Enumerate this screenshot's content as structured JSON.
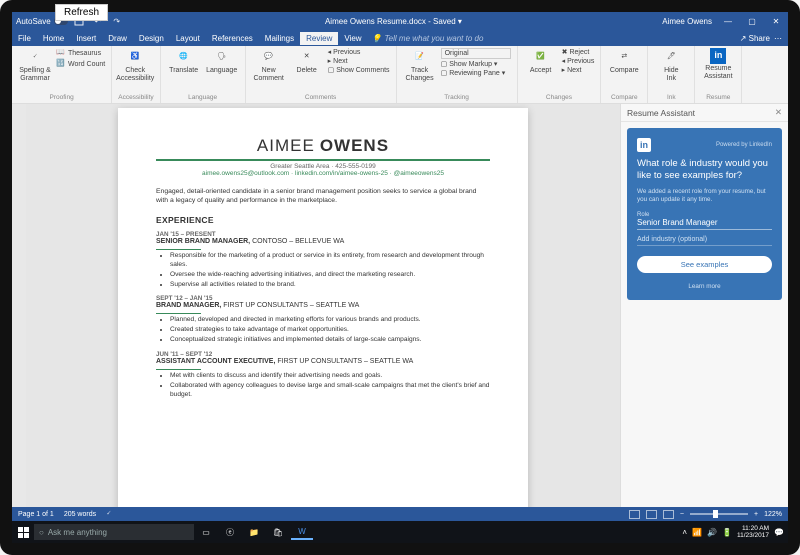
{
  "tooltip": {
    "refresh": "Refresh"
  },
  "titlebar": {
    "autosave_label": "AutoSave",
    "doc_title": "Aimee Owens Resume.docx - Saved ▾",
    "user": "Aimee Owens"
  },
  "tabs": {
    "items": [
      "File",
      "Home",
      "Insert",
      "Draw",
      "Design",
      "Layout",
      "References",
      "Mailings",
      "Review",
      "View"
    ],
    "tellme": "Tell me what you want to do",
    "share": "Share",
    "comments": "⋯"
  },
  "ribbon": {
    "proofing": {
      "label": "Proofing",
      "spelling": "Spelling &\nGrammar",
      "thesaurus": "Thesaurus",
      "wordcount": "Word Count"
    },
    "accessibility": {
      "label": "Accessibility",
      "check": "Check\nAccessibility"
    },
    "language": {
      "label": "Language",
      "translate": "Translate",
      "language": "Language"
    },
    "comments": {
      "label": "Comments",
      "new": "New\nComment",
      "delete": "Delete",
      "previous": "Previous",
      "next": "Next",
      "show": "Show Comments"
    },
    "tracking": {
      "label": "Tracking",
      "track": "Track\nChanges",
      "original": "Original",
      "markup": "Show Markup ▾",
      "pane": "Reviewing Pane ▾"
    },
    "changes": {
      "label": "Changes",
      "accept": "Accept",
      "reject": "Reject",
      "previous": "Previous",
      "next": "Next"
    },
    "compare": {
      "label": "Compare",
      "compare": "Compare"
    },
    "ink": {
      "label": "Ink",
      "hide": "Hide\nInk"
    },
    "resume": {
      "label": "Resume",
      "assistant": "Resume\nAssistant"
    }
  },
  "document": {
    "first_name": "AIMEE",
    "last_name": "OWENS",
    "contact1": "Greater Seattle Area  ·  425-555-0199",
    "contact2": "aimee.owens25@outlook.com · linkedin.com/in/aimee-owens-25 · @aimeeowens25",
    "summary": "Engaged, detail-oriented candidate in a senior brand management position seeks to service a global brand with a legacy of quality and performance in the marketplace.",
    "experience_heading": "EXPERIENCE",
    "jobs": [
      {
        "date": "JAN '15 – PRESENT",
        "title": "SENIOR BRAND MANAGER,",
        "company": " CONTOSO – BELLEVUE WA",
        "bullets": [
          "Responsible for the marketing of a product or service in its entirety, from research and development through sales.",
          "Oversee the wide-reaching advertising initiatives, and direct the marketing research.",
          "Supervise all activities related to the brand."
        ]
      },
      {
        "date": "SEPT '12 – JAN '15",
        "title": "BRAND MANAGER,",
        "company": " FIRST UP CONSULTANTS – SEATTLE WA",
        "bullets": [
          "Planned, developed and directed in marketing efforts for various brands and products.",
          "Created strategies to take advantage of market opportunities.",
          "Conceptualized strategic initiatives and implemented details of large-scale campaigns."
        ]
      },
      {
        "date": "JUN '11 – SEPT '12",
        "title": "ASSISTANT ACCOUNT EXECUTIVE,",
        "company": " FIRST UP CONSULTANTS – SEATTLE WA",
        "bullets": [
          "Met with clients to discuss and identify their advertising needs and goals.",
          "Collaborated with agency colleagues to devise large and small-scale campaigns that met the client's brief and budget."
        ]
      }
    ]
  },
  "assistant": {
    "title": "Resume Assistant",
    "powered": "Powered by LinkedIn",
    "question": "What role & industry would you like to see examples for?",
    "subtext": "We added a recent role from your resume, but you can update it any time.",
    "role_label": "Role",
    "role_value": "Senior Brand Manager",
    "add_industry": "Add industry (optional)",
    "button": "See examples",
    "learn": "Learn more"
  },
  "statusbar": {
    "page": "Page 1 of 1",
    "words": "205 words",
    "zoom": "122%"
  },
  "taskbar": {
    "search_placeholder": "Ask me anything",
    "time": "11:20 AM",
    "date": "11/23/2017"
  }
}
